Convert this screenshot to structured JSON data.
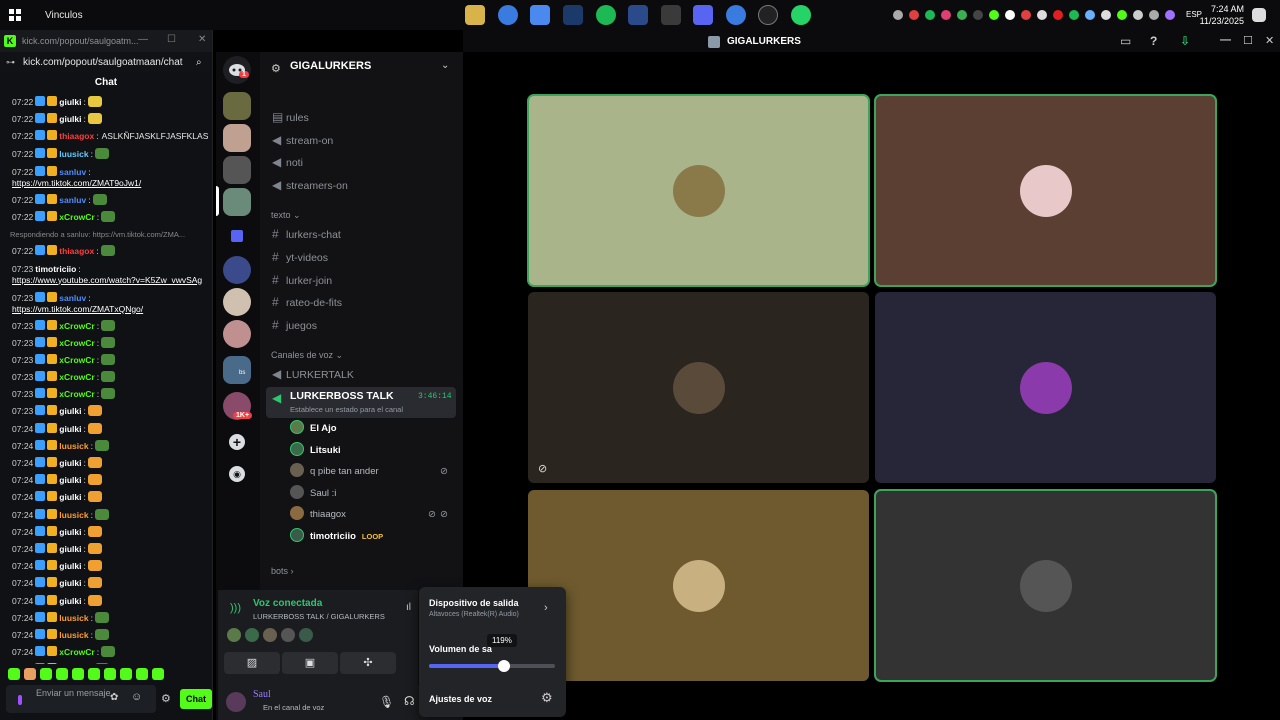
{
  "taskbar": {
    "label": "Vinculos",
    "lang": "ESP",
    "time": "7:24 AM",
    "date": "11/23/2025"
  },
  "kick": {
    "tab_title": "kick.com/popout/saulgoatm...",
    "url": "kick.com/popout/saulgoatmaan/chat",
    "chat_header": "Chat",
    "input_placeholder": "Enviar un mensaje",
    "chat_button": "Chat",
    "messages": [
      {
        "time": "07:22",
        "user": "giulki",
        "color": "#ffffff",
        "text": "",
        "emote": true
      },
      {
        "time": "07:22",
        "user": "giulki",
        "color": "#ffffff",
        "text": "",
        "emote": true
      },
      {
        "time": "07:22",
        "user": "thiaagox",
        "color": "#ff3b3b",
        "text": "ASLKÑFJASKLFJASFKLAS"
      },
      {
        "time": "07:22",
        "user": "luusick",
        "color": "#5ccfff",
        "text": "",
        "emote": true
      },
      {
        "time": "07:22",
        "user": "sanluv",
        "color": "#4d8dff",
        "text": "",
        "link": "https://vm.tiktok.com/ZMAT9oJw1/"
      },
      {
        "time": "07:22",
        "user": "sanluv",
        "color": "#4d8dff",
        "text": "",
        "emote": true
      },
      {
        "time": "07:22",
        "user": "xCrowCr",
        "color": "#53fc18",
        "text": "",
        "emote": true
      },
      {
        "reply": "Respondiendo a sanluv: https://vm.tiktok.com/ZMA..."
      },
      {
        "time": "07:22",
        "user": "thiaagox",
        "color": "#ff3b3b",
        "text": "",
        "emote": true
      },
      {
        "time": "07:23",
        "user": "timotriciio",
        "color": "#ffffff",
        "text": "",
        "link": "https://www.youtube.com/watch?v=K5Zw_vwvSAg"
      },
      {
        "time": "07:23",
        "user": "sanluv",
        "color": "#4d8dff",
        "text": "",
        "link": "https://vm.tiktok.com/ZMATxQNgo/"
      },
      {
        "time": "07:23",
        "user": "xCrowCr",
        "color": "#53fc18",
        "text": "",
        "emote": true
      },
      {
        "time": "07:23",
        "user": "xCrowCr",
        "color": "#53fc18",
        "text": "",
        "emote": true
      },
      {
        "time": "07:23",
        "user": "xCrowCr",
        "color": "#53fc18",
        "text": "",
        "emote": true
      },
      {
        "time": "07:23",
        "user": "xCrowCr",
        "color": "#53fc18",
        "text": "",
        "emote": true
      },
      {
        "time": "07:23",
        "user": "xCrowCr",
        "color": "#53fc18",
        "text": "",
        "emote": true
      },
      {
        "time": "07:23",
        "user": "giulki",
        "color": "#ffffff",
        "text": "",
        "emote": true
      },
      {
        "time": "07:24",
        "user": "giulki",
        "color": "#ffffff",
        "text": "",
        "emote": true
      },
      {
        "time": "07:24",
        "user": "luusick",
        "color": "#ff9d2e",
        "text": "",
        "emote": true
      },
      {
        "time": "07:24",
        "user": "giulki",
        "color": "#ffffff",
        "text": "",
        "emote": true
      },
      {
        "time": "07:24",
        "user": "giulki",
        "color": "#ffffff",
        "text": "",
        "emote": true
      },
      {
        "time": "07:24",
        "user": "giulki",
        "color": "#ffffff",
        "text": "",
        "emote": true
      },
      {
        "time": "07:24",
        "user": "luusick",
        "color": "#ff9d2e",
        "text": "",
        "emote": true
      },
      {
        "time": "07:24",
        "user": "giulki",
        "color": "#ffffff",
        "text": "",
        "emote": true
      },
      {
        "time": "07:24",
        "user": "giulki",
        "color": "#ffffff",
        "text": "",
        "emote": true
      },
      {
        "time": "07:24",
        "user": "giulki",
        "color": "#ffffff",
        "text": "",
        "emote": true
      },
      {
        "time": "07:24",
        "user": "giulki",
        "color": "#ffffff",
        "text": "",
        "emote": true
      },
      {
        "time": "07:24",
        "user": "giulki",
        "color": "#ffffff",
        "text": "",
        "emote": true
      },
      {
        "time": "07:24",
        "user": "luusick",
        "color": "#ff9d2e",
        "text": "",
        "emote": true
      },
      {
        "time": "07:24",
        "user": "luusick",
        "color": "#ff9d2e",
        "text": "",
        "emote": true
      },
      {
        "time": "07:24",
        "user": "xCrowCr",
        "color": "#53fc18",
        "text": "",
        "emote": true
      },
      {
        "time": "07:24",
        "user": "luusick",
        "color": "#ff9d2e",
        "text": "",
        "emote": true
      }
    ]
  },
  "discord": {
    "server_name": "GIGALURKERS",
    "window_title": "GIGALURKERS",
    "badge_count": "1",
    "badge_1k": "1K+",
    "bs_label": "bs",
    "channels_top": [
      "rules",
      "stream-on",
      "noti",
      "streamers-on"
    ],
    "category_text": "texto",
    "text_channels": [
      "lurkers-chat",
      "yt-videos",
      "lurker-join",
      "rateo-de-fits",
      "juegos"
    ],
    "category_voice": "Canales de voz",
    "voice_channels": [
      "LURKERTALK",
      "LURKERBOSS TALK"
    ],
    "voice_timer": "3:46:14",
    "voice_status": "Establece un estado para el canal",
    "voice_users": [
      {
        "name": "El Ajo",
        "bold": true
      },
      {
        "name": "Litsuki",
        "bold": true
      },
      {
        "name": "q pibe tan ander",
        "bold": false
      },
      {
        "name": "Saul :i",
        "bold": false
      },
      {
        "name": "thiaagox",
        "bold": false
      },
      {
        "name": "timotriciio",
        "bold": true,
        "tag": "LOOP"
      }
    ],
    "category_bots": "bots",
    "voice_connected": "Voz conectada",
    "voice_connected_sub": "LURKERBOSS TALK / GIGALURKERS",
    "user_name": "Saul",
    "user_status": "En el canal de voz"
  },
  "popup": {
    "title": "Dispositivo de salida",
    "subtitle": "Altavoces (Realtek(R) Audio)",
    "volume_label": "Volumen de sa",
    "volume_value": "119%",
    "volume_fraction": 0.595,
    "settings_label": "Ajustes de voz"
  },
  "tiles": [
    {
      "bg": "#a9b48a",
      "avatar": "#8a7a4a",
      "speaking": true
    },
    {
      "bg": "#5b3f33",
      "avatar": "#e8c8c8",
      "speaking": true
    },
    {
      "bg": "#2b2520",
      "avatar": "#5a4a3a",
      "speaking": false,
      "muted": true
    },
    {
      "bg": "#262638",
      "avatar": "#8a3aaa",
      "speaking": false
    },
    {
      "bg": "#6e5a2e",
      "avatar": "#c8b080",
      "speaking": false
    },
    {
      "bg": "#333333",
      "avatar": "#555555",
      "speaking": true
    }
  ]
}
